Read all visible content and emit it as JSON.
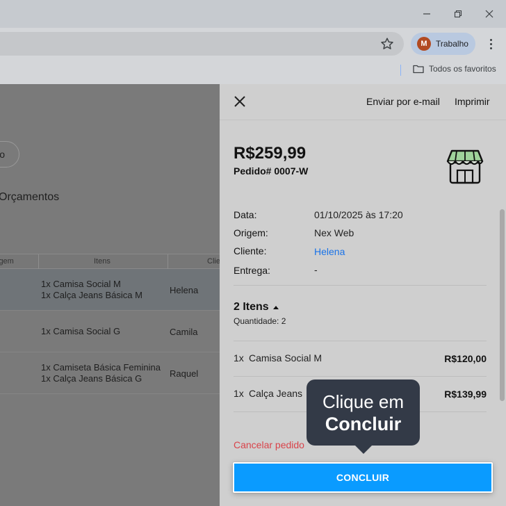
{
  "browser": {
    "profile_initial": "M",
    "profile_name": "Trabalho",
    "bookmarks_all": "Todos os favoritos"
  },
  "page": {
    "pill_button_label": "o",
    "heading": "Orçamentos",
    "table": {
      "headers": [
        "igem",
        "Itens",
        "Clie"
      ],
      "rows": [
        {
          "items": [
            "1x Camisa Social M",
            "1x Calça Jeans Básica M"
          ],
          "client": "Helena"
        },
        {
          "items": [
            "1x Camisa Social G"
          ],
          "client": "Camila"
        },
        {
          "items": [
            "1x Camiseta Básica Feminina",
            "1x Calça Jeans Básica G"
          ],
          "client": "Raquel"
        }
      ]
    }
  },
  "panel": {
    "email_label": "Enviar por e-mail",
    "print_label": "Imprimir",
    "total": "R$259,99",
    "order_number": "Pedido# 0007-W",
    "details": [
      {
        "label": "Data:",
        "value": "01/10/2025 às 17:20"
      },
      {
        "label": "Origem:",
        "value": "Nex Web"
      },
      {
        "label": "Cliente:",
        "value": "Helena"
      },
      {
        "label": "Entrega:",
        "value": "-"
      }
    ],
    "items_title": "2 Itens",
    "quantity": "Quantidade: 2",
    "items": [
      {
        "qty": "1x",
        "name": "Camisa Social M",
        "price": "R$120,00"
      },
      {
        "qty": "1x",
        "name": "Calça Jeans",
        "price": "R$139,99"
      }
    ],
    "cancel_label": "Cancelar pedido",
    "conclude_label": "CONCLUIR"
  },
  "tooltip": {
    "line1": "Clique em",
    "line2": "Concluir"
  },
  "colors": {
    "accent": "#0a9bff",
    "link": "#1a73e8",
    "danger": "#d9434a",
    "tooltip": "#333a47"
  }
}
